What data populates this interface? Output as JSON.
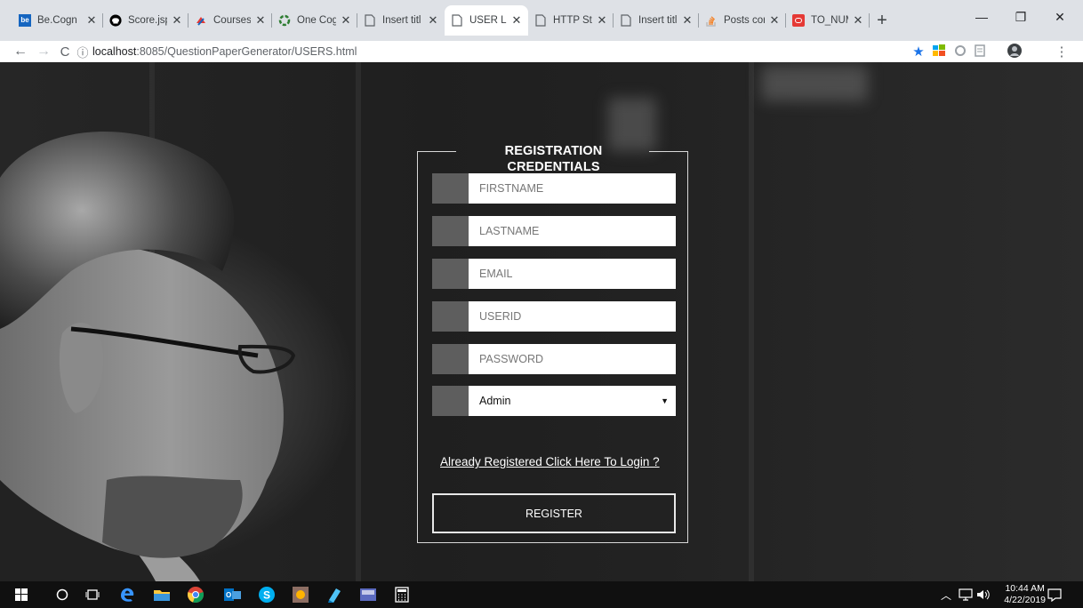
{
  "browser": {
    "tabs": [
      {
        "title": "Be.Cogn",
        "icon": "becognizant-icon",
        "color": "#1565c0",
        "active": false
      },
      {
        "title": "Score.jsp",
        "icon": "github-icon",
        "color": "#000000",
        "active": false
      },
      {
        "title": "Courses",
        "icon": "courses-icon",
        "color": "#e53935",
        "active": false
      },
      {
        "title": "One Cog",
        "icon": "onecog-icon",
        "color": "#2e7d32",
        "active": false
      },
      {
        "title": "Insert titl",
        "icon": "page-icon",
        "color": "#5f6368",
        "active": false
      },
      {
        "title": "USER LO",
        "icon": "page-icon",
        "color": "#5f6368",
        "active": true
      },
      {
        "title": "HTTP Sta",
        "icon": "page-icon",
        "color": "#5f6368",
        "active": false
      },
      {
        "title": "Insert titl",
        "icon": "page-icon",
        "color": "#5f6368",
        "active": false
      },
      {
        "title": "Posts cor",
        "icon": "stackoverflow-icon",
        "color": "#f48024",
        "active": false
      },
      {
        "title": "TO_NUM",
        "icon": "oracle-icon",
        "color": "#e53935",
        "active": false
      }
    ],
    "new_tab": "+",
    "url_host": "localhost",
    "url_rest": ":8085/QuestionPaperGenerator/USERS.html"
  },
  "form": {
    "legend": "REGISTRATION CREDENTIALS",
    "fields": {
      "firstname": "FIRSTNAME",
      "lastname": "LASTNAME",
      "email": "EMAIL",
      "userid": "USERID",
      "password": "PASSWORD"
    },
    "role_selected": "Admin",
    "login_link": "Already Registered Click Here To Login ?",
    "register_button": "REGISTER"
  },
  "taskbar": {
    "time": "10:44 AM",
    "date": "4/22/2019"
  },
  "colors": {
    "accent_star": "#1a73e8",
    "field_square": "#5e5e5e"
  }
}
